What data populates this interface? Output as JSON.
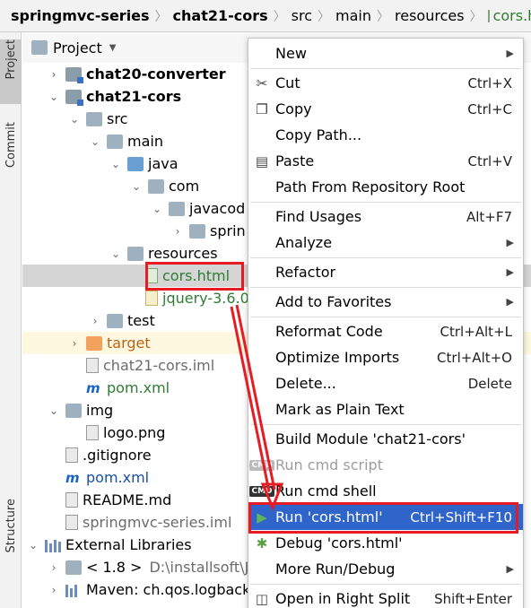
{
  "breadcrumb": [
    "springmvc-series",
    "chat21-cors",
    "src",
    "main",
    "resources",
    "cors.html"
  ],
  "left_strip": {
    "project_tab": "Project",
    "commit_tab": "Commit",
    "structure_tab": "Structure"
  },
  "project_pane": {
    "title": "Project"
  },
  "tree": {
    "chat20": "chat20-converter",
    "chat21": "chat21-cors",
    "src": "src",
    "main": "main",
    "java": "java",
    "com": "com",
    "javacode": "javacod",
    "spring": "sprin",
    "resources": "resources",
    "cors": "cors.html",
    "jquery": "jquery-3.6.0",
    "test": "test",
    "target": "target",
    "iml": "chat21-cors.iml",
    "pom1": "pom.xml",
    "img": "img",
    "logo": "logo.png",
    "gitignore": ".gitignore",
    "pom2": "pom.xml",
    "readme": "README.md",
    "iml2": "springmvc-series.iml",
    "extlibs": "External Libraries",
    "jdk": "< 1.8 >",
    "jdk_path": "D:\\installsoft\\J",
    "maven": "Maven: ch.qos.logback"
  },
  "menu": {
    "new": "New",
    "cut": "Cut",
    "cut_sc": "Ctrl+X",
    "copy": "Copy",
    "copy_sc": "Ctrl+C",
    "copy_path": "Copy Path...",
    "paste": "Paste",
    "paste_sc": "Ctrl+V",
    "path_root": "Path From Repository Root",
    "find_usages": "Find Usages",
    "find_usages_sc": "Alt+F7",
    "analyze": "Analyze",
    "refactor": "Refactor",
    "favorites": "Add to Favorites",
    "reformat": "Reformat Code",
    "reformat_sc": "Ctrl+Alt+L",
    "optimize": "Optimize Imports",
    "optimize_sc": "Ctrl+Alt+O",
    "delete": "Delete...",
    "delete_sc": "Delete",
    "plain_text": "Mark as Plain Text",
    "build_module": "Build Module 'chat21-cors'",
    "run_cmd_script": "Run cmd script",
    "run_cmd_shell": "Run cmd shell",
    "run": "Run 'cors.html'",
    "run_sc": "Ctrl+Shift+F10",
    "debug": "Debug 'cors.html'",
    "more_run": "More Run/Debug",
    "open_split": "Open in Right Split",
    "open_split_sc": "Shift+Enter"
  },
  "colors": {
    "highlight": "#2f65ca",
    "annotation_red": "#e51c23"
  }
}
